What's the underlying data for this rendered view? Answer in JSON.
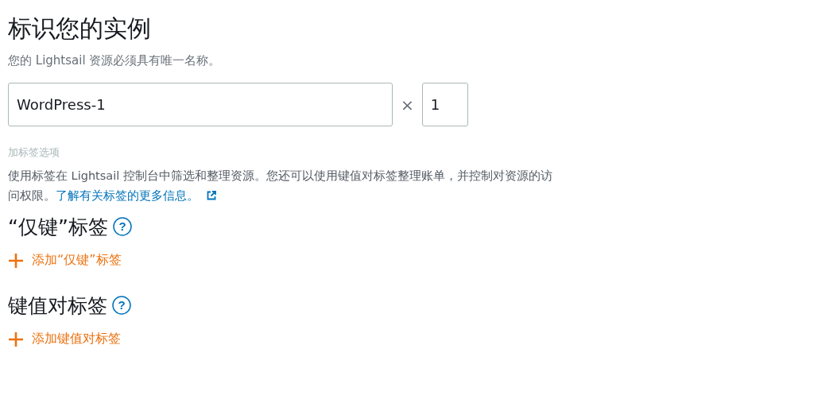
{
  "title": "标识您的实例",
  "subtitle": "您的 Lightsail 资源必须具有唯一名称。",
  "name_field": {
    "value": "WordPress-1"
  },
  "multiplier": "×",
  "count_field": {
    "value": "1"
  },
  "tag_options_label": "加标签选项",
  "tag_description": {
    "text": "使用标签在 Lightsail 控制台中筛选和整理资源。您还可以使用键值对标签整理账单，并控制对资源的访问权限。",
    "link": "了解有关标签的更多信息。"
  },
  "sections": [
    {
      "heading": "“仅键”标签",
      "help": "?",
      "add_label": "添加“仅键”标签"
    },
    {
      "heading": "键值对标签",
      "help": "?",
      "add_label": "添加键值对标签"
    }
  ]
}
